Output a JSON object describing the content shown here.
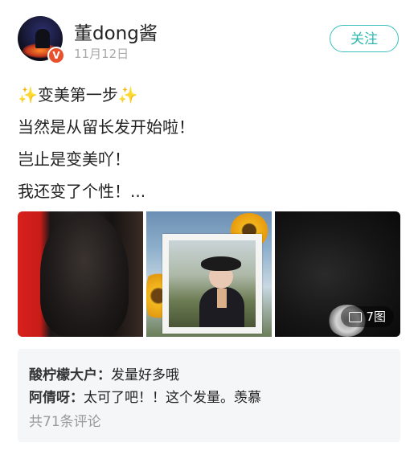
{
  "header": {
    "username": "董dong酱",
    "date": "11月12日",
    "follow_label": "关注",
    "verified_badge": "V"
  },
  "post": {
    "sparkle_left": "✨",
    "sparkle_right": "✨",
    "line1": "变美第一步",
    "line2": "当然是从留长发开始啦！",
    "line3": "岂止是变美吖！",
    "line4": "我还变了个性！..."
  },
  "images": {
    "count_label": "7图",
    "icons": [
      "hair-photo",
      "portrait-photo",
      "hair-scrunchie-photo"
    ]
  },
  "comments": {
    "items": [
      {
        "author": "酸柠檬大户：",
        "text": "发量好多哦"
      },
      {
        "author": "阿倩呀：",
        "text": "太可了吧！！这个发量。羡慕"
      }
    ],
    "total_label": "共71条评论"
  },
  "colors": {
    "accent": "#39c0ba",
    "badge": "#e8512c",
    "comment_bg": "#f5f6f8"
  }
}
